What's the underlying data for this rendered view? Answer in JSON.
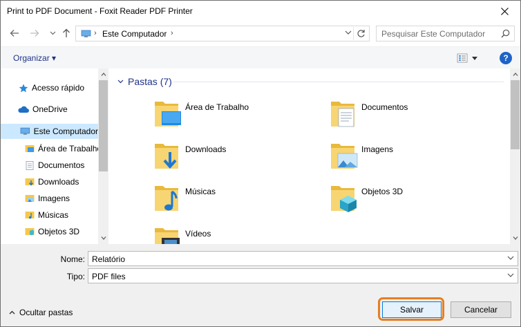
{
  "window": {
    "title": "Print to PDF Document - Foxit Reader PDF Printer"
  },
  "address": {
    "path": "Este Computador",
    "search_placeholder": "Pesquisar Este Computador"
  },
  "toolbar": {
    "organize_label": "Organizar ▾",
    "help_label": "?"
  },
  "navpane": {
    "items": [
      {
        "label": "Acesso rápido",
        "icon": "star-icon"
      },
      {
        "label": "OneDrive",
        "icon": "cloud-icon"
      },
      {
        "label": "Este Computador",
        "icon": "computer-icon",
        "selected": true
      },
      {
        "label": "Área de Trabalho",
        "icon": "desktop-folder-icon"
      },
      {
        "label": "Documentos",
        "icon": "documents-folder-icon"
      },
      {
        "label": "Downloads",
        "icon": "downloads-folder-icon"
      },
      {
        "label": "Imagens",
        "icon": "pictures-folder-icon"
      },
      {
        "label": "Músicas",
        "icon": "music-folder-icon"
      },
      {
        "label": "Objetos 3D",
        "icon": "3d-objects-folder-icon"
      }
    ]
  },
  "content": {
    "group_label": "Pastas (7)",
    "folders": [
      {
        "label": "Área de Trabalho",
        "icon": "desktop-folder-icon"
      },
      {
        "label": "Documentos",
        "icon": "documents-folder-icon"
      },
      {
        "label": "Downloads",
        "icon": "downloads-folder-icon"
      },
      {
        "label": "Imagens",
        "icon": "pictures-folder-icon"
      },
      {
        "label": "Músicas",
        "icon": "music-folder-icon"
      },
      {
        "label": "Objetos 3D",
        "icon": "3d-objects-folder-icon"
      },
      {
        "label": "Vídeos",
        "icon": "videos-folder-icon"
      }
    ]
  },
  "form": {
    "name_label": "Nome:",
    "name_value": "Relatório",
    "type_label": "Tipo:",
    "type_value": "PDF files",
    "hide_folders_label": "Ocultar pastas",
    "save_label": "Salvar",
    "cancel_label": "Cancelar"
  },
  "colors": {
    "accent": "#1e3287",
    "selection": "#cce8ff",
    "folder_yellow": "#f5c84c",
    "highlight": "#e67e22"
  }
}
